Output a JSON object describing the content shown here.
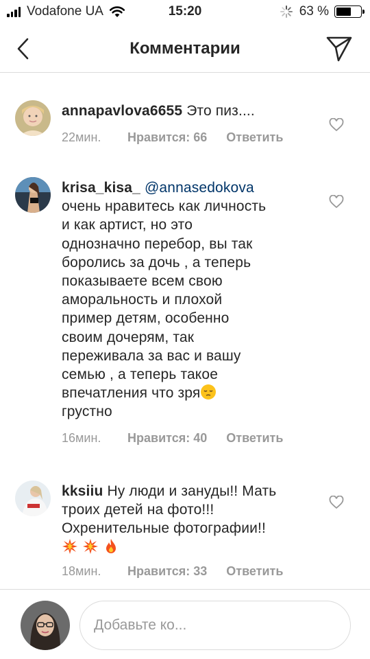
{
  "status_bar": {
    "carrier": "Vodafone UA",
    "time": "15:20",
    "battery_percent": "63 %",
    "battery_level": 0.63
  },
  "header": {
    "title": "Комментарии",
    "back_icon": "chevron-left-icon",
    "send_icon": "paper-plane-icon"
  },
  "comments": [
    {
      "username": "annapavlova6655",
      "mention": "",
      "text": "Это пиз....",
      "time": "22мин.",
      "likes": "Нравится: 66",
      "reply": "Ответить"
    },
    {
      "username": "krisa_kisa_",
      "mention": "@annasedokova",
      "lines": [
        "очень нравитесь как личность",
        "и как артист, но это",
        "однозначно перебор, вы так",
        "боролись за дочь , а теперь",
        "показываете всем свою",
        "аморальность и плохой",
        "пример детям, особенно",
        "своим дочерям, так",
        "переживала за вас и вашу",
        "семью , а теперь такое",
        "впечатления что зря",
        "грустно"
      ],
      "emoji": "pensive-face",
      "time": "16мин.",
      "likes": "Нравится: 40",
      "reply": "Ответить"
    },
    {
      "username": "kksiiu",
      "lines": [
        "Ну люди и зануды!! Мать",
        "троих детей на фото!!!",
        "Охренительные фотографии!!"
      ],
      "emoji_row": [
        "collision",
        "collision",
        "fire"
      ],
      "time": "18мин.",
      "likes": "Нравится: 33",
      "reply": "Ответить"
    }
  ],
  "composer": {
    "placeholder": "Добавьте ко..."
  },
  "colors": {
    "text": "#262626",
    "meta": "#999999",
    "mention": "#003569",
    "divider": "#dbdbdb"
  }
}
